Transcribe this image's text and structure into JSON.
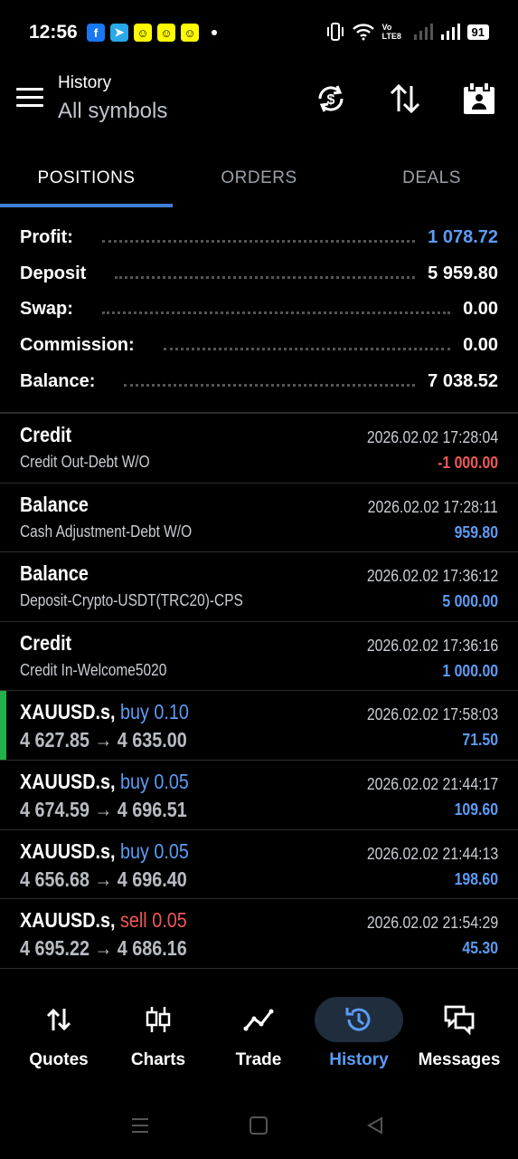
{
  "status_bar": {
    "time": "12:56",
    "battery": "91",
    "network": "Vo LTE8"
  },
  "header": {
    "title_small": "History",
    "title_big": "All symbols"
  },
  "tabs": [
    {
      "label": "POSITIONS"
    },
    {
      "label": "ORDERS"
    },
    {
      "label": "DEALS"
    }
  ],
  "summary": [
    {
      "label": "Profit:",
      "value": "1 078.72"
    },
    {
      "label": "Deposit",
      "value": "5 959.80"
    },
    {
      "label": "Swap:",
      "value": "0.00"
    },
    {
      "label": "Commission:",
      "value": "0.00"
    },
    {
      "label": "Balance:",
      "value": "7 038.52"
    }
  ],
  "deals": [
    {
      "title": "Credit",
      "sub": "Credit Out-Debt W/O",
      "time": "2026.02.02 17:28:04",
      "amount": "-1 000.00"
    },
    {
      "title": "Balance",
      "sub": "Cash Adjustment-Debt W/O",
      "time": "2026.02.02 17:28:11",
      "amount": "959.80"
    },
    {
      "title": "Balance",
      "sub": "Deposit-Crypto-USDT(TRC20)-CPS",
      "time": "2026.02.02 17:36:12",
      "amount": "5 000.00"
    },
    {
      "title": "Credit",
      "sub": "Credit In-Welcome5020",
      "time": "2026.02.02 17:36:16",
      "amount": "1 000.00"
    },
    {
      "symbol": "XAUUSD.s,",
      "side": "buy 0.10",
      "prices": "4 627.85 → 4 635.00",
      "time": "2026.02.02 17:58:03",
      "amount": "71.50"
    },
    {
      "symbol": "XAUUSD.s,",
      "side": "buy 0.05",
      "prices": "4 674.59 → 4 696.51",
      "time": "2026.02.02 21:44:17",
      "amount": "109.60"
    },
    {
      "symbol": "XAUUSD.s,",
      "side": "buy 0.05",
      "prices": "4 656.68 → 4 696.40",
      "time": "2026.02.02 21:44:13",
      "amount": "198.60"
    },
    {
      "symbol": "XAUUSD.s,",
      "side": "sell 0.05",
      "prices": "4 695.22 → 4 686.16",
      "time": "2026.02.02 21:54:29",
      "amount": "45.30"
    }
  ],
  "bottom_nav": [
    {
      "label": "Quotes",
      "icon": "quotes-icon"
    },
    {
      "label": "Charts",
      "icon": "charts-icon"
    },
    {
      "label": "Trade",
      "icon": "trade-icon"
    },
    {
      "label": "History",
      "icon": "history-icon"
    },
    {
      "label": "Messages",
      "icon": "messages-icon"
    }
  ],
  "colors": {
    "accent": "#5b9cf5",
    "negative": "#f25757",
    "positive_marker": "#22b14c",
    "background": "#000000"
  }
}
